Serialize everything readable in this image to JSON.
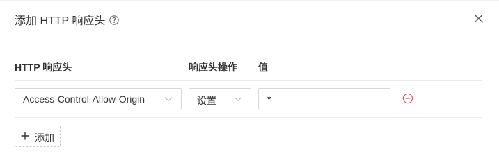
{
  "dialog": {
    "title": "添加 HTTP 响应头"
  },
  "table": {
    "columns": [
      "HTTP 响应头",
      "响应头操作",
      "值"
    ],
    "rows": [
      {
        "header": "Access-Control-Allow-Origin",
        "operation": "设置",
        "value": "*"
      }
    ]
  },
  "actions": {
    "add_label": "添加"
  },
  "colors": {
    "remove_icon": "#e0464b",
    "border": "#d4d6d9",
    "divider": "#e9ebee"
  }
}
